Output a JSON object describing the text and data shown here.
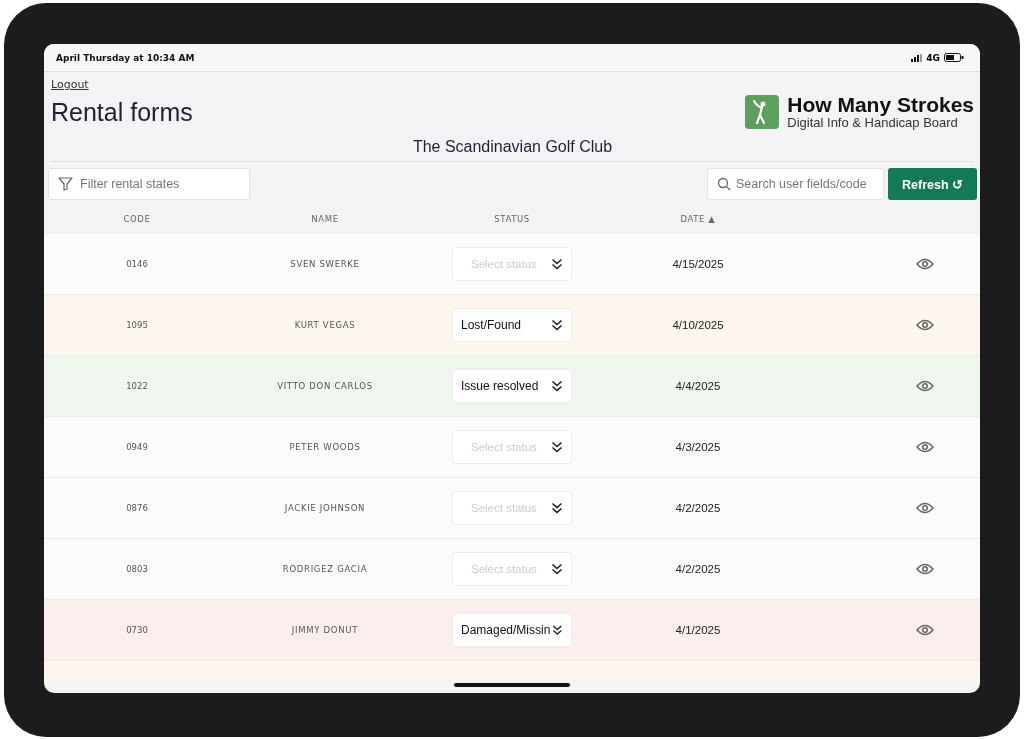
{
  "status_bar": {
    "time": "April Thursday at 10:34 AM",
    "network": "4G"
  },
  "logout": "Logout",
  "title": "Rental forms",
  "brand": {
    "name": "How Many Strokes",
    "tagline": "Digital Info & Handicap Board"
  },
  "club": "The Scandinavian Golf Club",
  "filter": {
    "placeholder": "Filter rental states"
  },
  "search": {
    "placeholder": "Search user fields/code"
  },
  "refresh_button": "Refresh ↺",
  "table": {
    "columns": [
      "CODE",
      "NAME",
      "STATUS",
      "DATE ▲"
    ],
    "rows": [
      {
        "code": "0146",
        "name": "SVEN SWERKE",
        "status": {
          "placeholder": "Select status"
        },
        "date": "4/15/2025",
        "color": "#fbfbfb"
      },
      {
        "code": "1095",
        "name": "KURT VEGAS",
        "status": {
          "value": "Lost/Found"
        },
        "date": "4/10/2025",
        "color": "#fdf6ec"
      },
      {
        "code": "1022",
        "name": "VITTO DON CARLOS",
        "status": {
          "value": "Issue resolved"
        },
        "date": "4/4/2025",
        "color": "#eef6ee"
      },
      {
        "code": "0949",
        "name": "PETER WOODS",
        "status": {
          "placeholder": "Select status"
        },
        "date": "4/3/2025",
        "color": "#fbfbfb"
      },
      {
        "code": "0876",
        "name": "JACKIE JOHNSON",
        "status": {
          "placeholder": "Select status"
        },
        "date": "4/2/2025",
        "color": "#fbfbfb"
      },
      {
        "code": "0803",
        "name": "RODRIGEZ GACIA",
        "status": {
          "placeholder": "Select status"
        },
        "date": "4/2/2025",
        "color": "#fbfbfb"
      },
      {
        "code": "0730",
        "name": "JIMMY DONUT",
        "status": {
          "value": "Damaged/Missin"
        },
        "date": "4/1/2025",
        "color": "#fdeeee"
      }
    ]
  }
}
